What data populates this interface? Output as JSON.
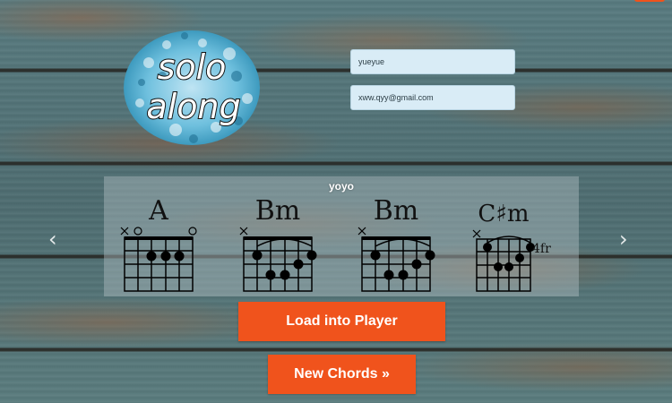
{
  "logo": {
    "line1": "solo",
    "line2": "along"
  },
  "form": {
    "name_value": "yueyue",
    "email_value": "xww.qyy@gmail.com"
  },
  "song": {
    "title": "yoyo"
  },
  "chords": [
    {
      "name": "A",
      "markers": "×o o",
      "fret_label": ""
    },
    {
      "name": "Bm",
      "markers": "×",
      "fret_label": ""
    },
    {
      "name": "Bm",
      "markers": "×",
      "fret_label": ""
    },
    {
      "name": "C♯m",
      "markers": "×",
      "fret_label": "4fr"
    }
  ],
  "nav": {
    "prev_icon": "‹",
    "next_icon": "›"
  },
  "buttons": {
    "load_label": "Load into Player",
    "new_label": "New Chords »"
  },
  "colors": {
    "accent": "#f0531c",
    "field_bg": "#d9ecf6",
    "logo_blue": "#5fb6d6"
  }
}
